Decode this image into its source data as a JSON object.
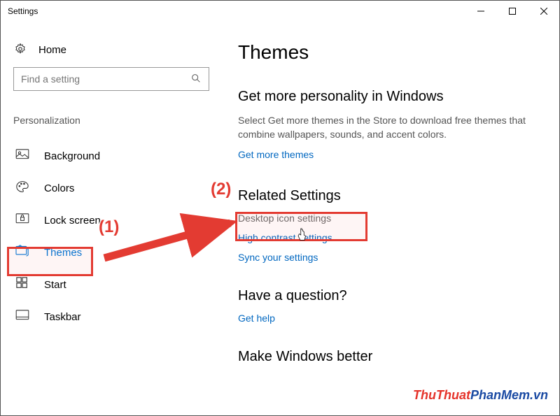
{
  "window": {
    "title": "Settings"
  },
  "sidebar": {
    "home": "Home",
    "search_placeholder": "Find a setting",
    "section": "Personalization",
    "items": [
      {
        "label": "Background"
      },
      {
        "label": "Colors"
      },
      {
        "label": "Lock screen"
      },
      {
        "label": "Themes"
      },
      {
        "label": "Start"
      },
      {
        "label": "Taskbar"
      }
    ]
  },
  "main": {
    "title": "Themes",
    "personality": {
      "heading": "Get more personality in Windows",
      "desc": "Select Get more themes in the Store to download free themes that combine wallpapers, sounds, and accent colors.",
      "link": "Get more themes"
    },
    "related": {
      "heading": "Related Settings",
      "links": [
        "Desktop icon settings",
        "High contrast settings",
        "Sync your settings"
      ]
    },
    "question": {
      "heading": "Have a question?",
      "link": "Get help"
    },
    "better": {
      "heading": "Make Windows better"
    }
  },
  "annotations": {
    "step1": "(1)",
    "step2": "(2)"
  },
  "watermark": {
    "part1": "ThuThuat",
    "part2": "PhanMem",
    "part3": ".vn"
  }
}
